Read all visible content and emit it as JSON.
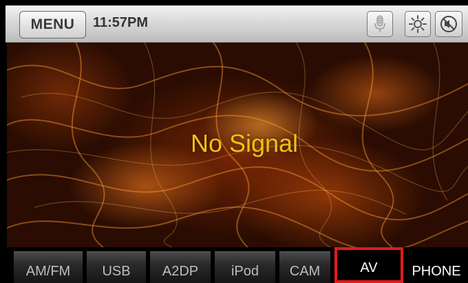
{
  "topbar": {
    "menu_label": "MENU",
    "time": "11:57PM",
    "icons": [
      "microphone-icon",
      "brightness-icon",
      "mute-icon"
    ]
  },
  "video": {
    "status_text": "No Signal"
  },
  "sources": {
    "items": [
      {
        "label": "AM/FM",
        "selected": false
      },
      {
        "label": "USB",
        "selected": false
      },
      {
        "label": "A2DP",
        "selected": false
      },
      {
        "label": "iPod",
        "selected": false
      },
      {
        "label": "CAM",
        "selected": false
      },
      {
        "label": "AV",
        "selected": true
      },
      {
        "label": "PHONE",
        "selected": false
      }
    ]
  },
  "colors": {
    "no_signal_text": "#f2c011",
    "selected_border": "#e01b1b"
  }
}
